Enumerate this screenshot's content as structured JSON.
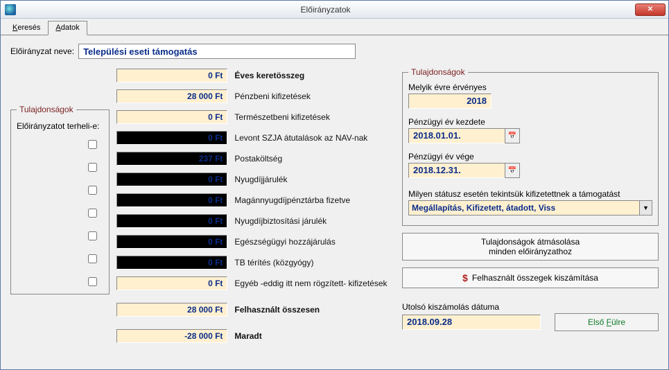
{
  "window": {
    "title": "Előirányzatok"
  },
  "tabs": {
    "search": "Keresés",
    "data": "Adatok"
  },
  "name_field": {
    "label": "Előirányzat neve:",
    "value": "Települési eseti támogatás"
  },
  "left_group": {
    "legend": "Tulajdonságok",
    "question": "Előirányzatot terheli-e:"
  },
  "rows": [
    {
      "value": "0 Ft",
      "label": "Éves keretösszeg",
      "style": "light",
      "bold": true
    },
    {
      "value": "28 000 Ft",
      "label": "Pénzbeni kifizetések",
      "style": "light",
      "bold": false
    },
    {
      "value": "0 Ft",
      "label": "Természetbeni kifizetések",
      "style": "light",
      "bold": false
    },
    {
      "value": "0 Ft",
      "label": "Levont SZJA átutalások az NAV-nak",
      "style": "dark",
      "bold": false
    },
    {
      "value": "237 Ft",
      "label": "Postaköltség",
      "style": "dark",
      "bold": false
    },
    {
      "value": "0 Ft",
      "label": "Nyugdíjjárulék",
      "style": "dark",
      "bold": false
    },
    {
      "value": "0 Ft",
      "label": "Magánnyugdíjpénztárba fizetve",
      "style": "dark",
      "bold": false
    },
    {
      "value": "0 Ft",
      "label": "Nyugdíjbiztosítási járulék",
      "style": "dark",
      "bold": false
    },
    {
      "value": "0 Ft",
      "label": "Egészségügyi hozzájárulás",
      "style": "dark",
      "bold": false
    },
    {
      "value": "0 Ft",
      "label": "TB térítés (közgyógy)",
      "style": "dark",
      "bold": false
    },
    {
      "value": "0 Ft",
      "label": "Egyéb -eddig itt nem rögzített- kifizetések",
      "style": "light",
      "bold": false
    },
    {
      "value": "28 000 Ft",
      "label": "Felhasznált összesen",
      "style": "light",
      "bold": true
    },
    {
      "value": "-28 000 Ft",
      "label": "Maradt",
      "style": "light",
      "bold": true
    }
  ],
  "right_group": {
    "legend": "Tulajdonságok",
    "year_label": "Melyik évre érvényes",
    "year_value": "2018",
    "fy_start_label": "Pénzügyi év kezdete",
    "fy_start_value": "2018.01.01.",
    "fy_end_label": "Pénzügyi év vége",
    "fy_end_value": "2018.12.31.",
    "status_label": "Milyen státusz esetén tekintsük kifizetettnek a támogatást",
    "status_value": "Megállapítás, Kifizetett, átadott, Viss"
  },
  "buttons": {
    "copy_props_line1": "Tulajdonságok átmásolása",
    "copy_props_line2": "minden előirányzathoz",
    "recompute": "Felhasznált összegek kiszámítása",
    "first_tab": "Első Fülre"
  },
  "last_calc": {
    "label": "Utolsó kiszámolás dátuma",
    "value": "2018.09.28"
  }
}
